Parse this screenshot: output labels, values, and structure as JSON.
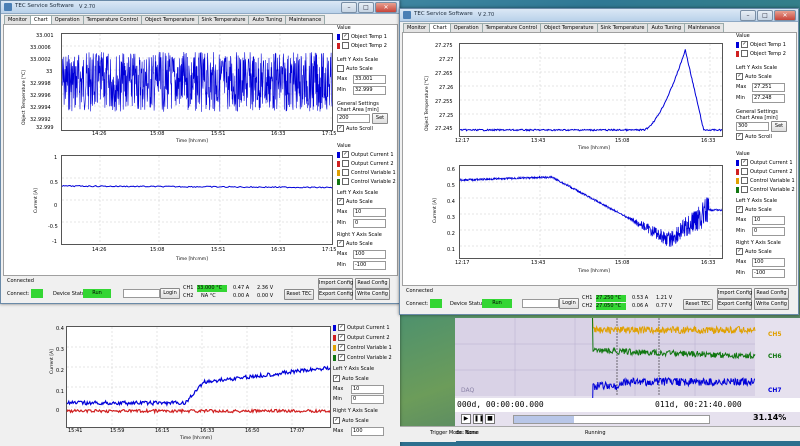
{
  "colors": {
    "blue": "#0000d8",
    "red": "#d02020",
    "green": "#117711",
    "orange": "#e0a000",
    "led": "#33d633"
  },
  "left": {
    "title": "TEC Service Software",
    "version": "V 2.70",
    "tabs": [
      "Monitor",
      "Chart",
      "Operation",
      "Temperature Control",
      "Object Temperature",
      "Sink Temperature",
      "Auto Tuning",
      "Maintenance"
    ],
    "top_chart": {
      "ylabel": "Object Temperature [°C]",
      "yticks": [
        "33.001",
        "33.0006",
        "33.0002",
        "33",
        "32.9998",
        "32.9996",
        "32.9994",
        "32.9992",
        "32.999"
      ],
      "xticks": [
        "14:26",
        "15:08",
        "15:51",
        "16:33",
        "17:15"
      ],
      "xtitle": "Time [hh:mm]"
    },
    "top_side": {
      "value": "Value",
      "legend": [
        "Object Temp 1",
        "Object Temp 2"
      ],
      "left_axis": "Left Y Axis Scale",
      "auto_scale": "Auto Scale",
      "max_label": "Max",
      "max": "33.001",
      "min_label": "Min",
      "min": "32.999",
      "general": "General Settings",
      "chart_area": "Chart Area [min]",
      "chart_area_value": "200",
      "set": "Set",
      "auto_scroll": "Auto Scroll"
    },
    "bottom_chart": {
      "ylabel": "Current [A]",
      "yticks": [
        "1",
        "0.5",
        "0",
        "-0.5",
        "-1"
      ],
      "xticks": [
        "14:26",
        "15:08",
        "15:51",
        "16:33",
        "17:15"
      ],
      "xtitle": "Time [hh:mm]"
    },
    "bottom_side": {
      "value": "Value",
      "legend": [
        "Output Current 1",
        "Output Current 2",
        "Control Variable 1",
        "Control Variable 2"
      ],
      "left_axis": "Left Y Axis Scale",
      "auto_scale": "Auto Scale",
      "max_label": "Max",
      "max": "10",
      "min_label": "Min",
      "min": "0",
      "right_axis": "Right Y Axis Scale",
      "auto_scale2": "Auto Scale",
      "max2": "100",
      "min2": "-100"
    },
    "status": {
      "connected": "Connected",
      "connect": "Connect:",
      "device_status": "Device Status",
      "run": "Run",
      "login": "Login",
      "ch1": "CH1",
      "ch2": "CH2",
      "ch1_temp": "33.000 °C",
      "ch2_temp": "NA °C",
      "ch1_a": "0.47 A",
      "ch2_a": "0.00 A",
      "ch1_v": "2.36 V",
      "ch2_v": "0.00 V",
      "reset": "Reset TEC",
      "import": "Import Config",
      "read": "Read Config",
      "export": "Export Config",
      "write": "Write Config"
    }
  },
  "right": {
    "title": "TEC Service Software",
    "version": "V 2.70",
    "tabs": [
      "Monitor",
      "Chart",
      "Operation",
      "Temperature Control",
      "Object Temperature",
      "Sink Temperature",
      "Auto Tuning",
      "Maintenance"
    ],
    "top_chart": {
      "ylabel": "Object Temperature [°C]",
      "yticks": [
        "27.275",
        "27.27",
        "27.265",
        "27.26",
        "27.255",
        "27.25",
        "27.245"
      ],
      "xticks": [
        "12:17",
        "13:43",
        "15:08",
        "16:33"
      ],
      "xtitle": "Time [hh:mm]"
    },
    "top_side": {
      "value": "Value",
      "legend": [
        "Object Temp 1",
        "Object Temp 2"
      ],
      "left_axis": "Left Y Axis Scale",
      "auto_scale": "Auto Scale",
      "max_label": "Max",
      "max": "27.251",
      "min_label": "Min",
      "min": "27.248",
      "general": "General Settings",
      "chart_area": "Chart Area [min]",
      "chart_area_value": "300",
      "set": "Set",
      "auto_scroll": "Auto Scroll"
    },
    "bottom_chart": {
      "ylabel": "Current [A]",
      "yticks": [
        "0.6",
        "0.5",
        "0.4",
        "0.3",
        "0.2",
        "0.1"
      ],
      "xticks": [
        "12:17",
        "13:43",
        "15:08",
        "16:33"
      ],
      "xtitle": "Time [hh:mm]"
    },
    "bottom_side": {
      "value": "Value",
      "legend": [
        "Output Current 1",
        "Output Current 2",
        "Control Variable 1",
        "Control Variable 2"
      ],
      "left_axis": "Left Y Axis Scale",
      "auto_scale": "Auto Scale",
      "max_label": "Max",
      "max": "10",
      "min_label": "Min",
      "min": "0",
      "right_axis": "Right Y Axis Scale",
      "auto_scale2": "Auto Scale",
      "max2": "100",
      "min2": "-100"
    },
    "status": {
      "connected": "Connected",
      "connect": "Connect:",
      "device_status": "Device Status",
      "run": "Run",
      "login": "Login",
      "ch1": "CH1",
      "ch2": "CH2",
      "ch1_temp": "27.250 °C",
      "ch2_temp": "27.050 °C",
      "ch1_a": "0.53 A",
      "ch2_a": "0.06 A",
      "ch1_v": "1.21 V",
      "ch2_v": "0.77 V",
      "reset": "Reset TEC",
      "import": "Import Config",
      "read": "Read Config",
      "export": "Export Config",
      "write": "Write Config"
    }
  },
  "back": {
    "xticks_top": [
      "15:41",
      "15:59",
      "16:15",
      "16:33",
      "16:50",
      "17:07"
    ],
    "ylabel": "Current [A]",
    "yticks": [
      "0.4",
      "0.3",
      "0.2",
      "0.1",
      "0"
    ],
    "xticks": [
      "15:41",
      "15:59",
      "16:15",
      "16:33",
      "16:50",
      "17:07"
    ],
    "xtitle": "Time [hh:mm]",
    "legend": [
      "Output Current 1",
      "Output Current 2",
      "Control Variable 1",
      "Control Variable 2"
    ],
    "left_axis": "Left Y Axis Scale",
    "auto_scale": "Auto Scale",
    "max_label": "Max",
    "max": "10",
    "min_label": "Min",
    "min": "0",
    "right_axis": "Right Y Axis Scale",
    "auto_scale2": "Auto Scale",
    "max2": "100"
  },
  "daq": {
    "labels": [
      "CH5",
      "CH6",
      "CH7"
    ],
    "tag": "DAQ",
    "time_start": "000d, 00:00:00.000",
    "time_end": "011d, 00:21:40.000",
    "percent": "31.14%",
    "trigger": "Trigger Mode:  None",
    "running": "Running"
  }
}
